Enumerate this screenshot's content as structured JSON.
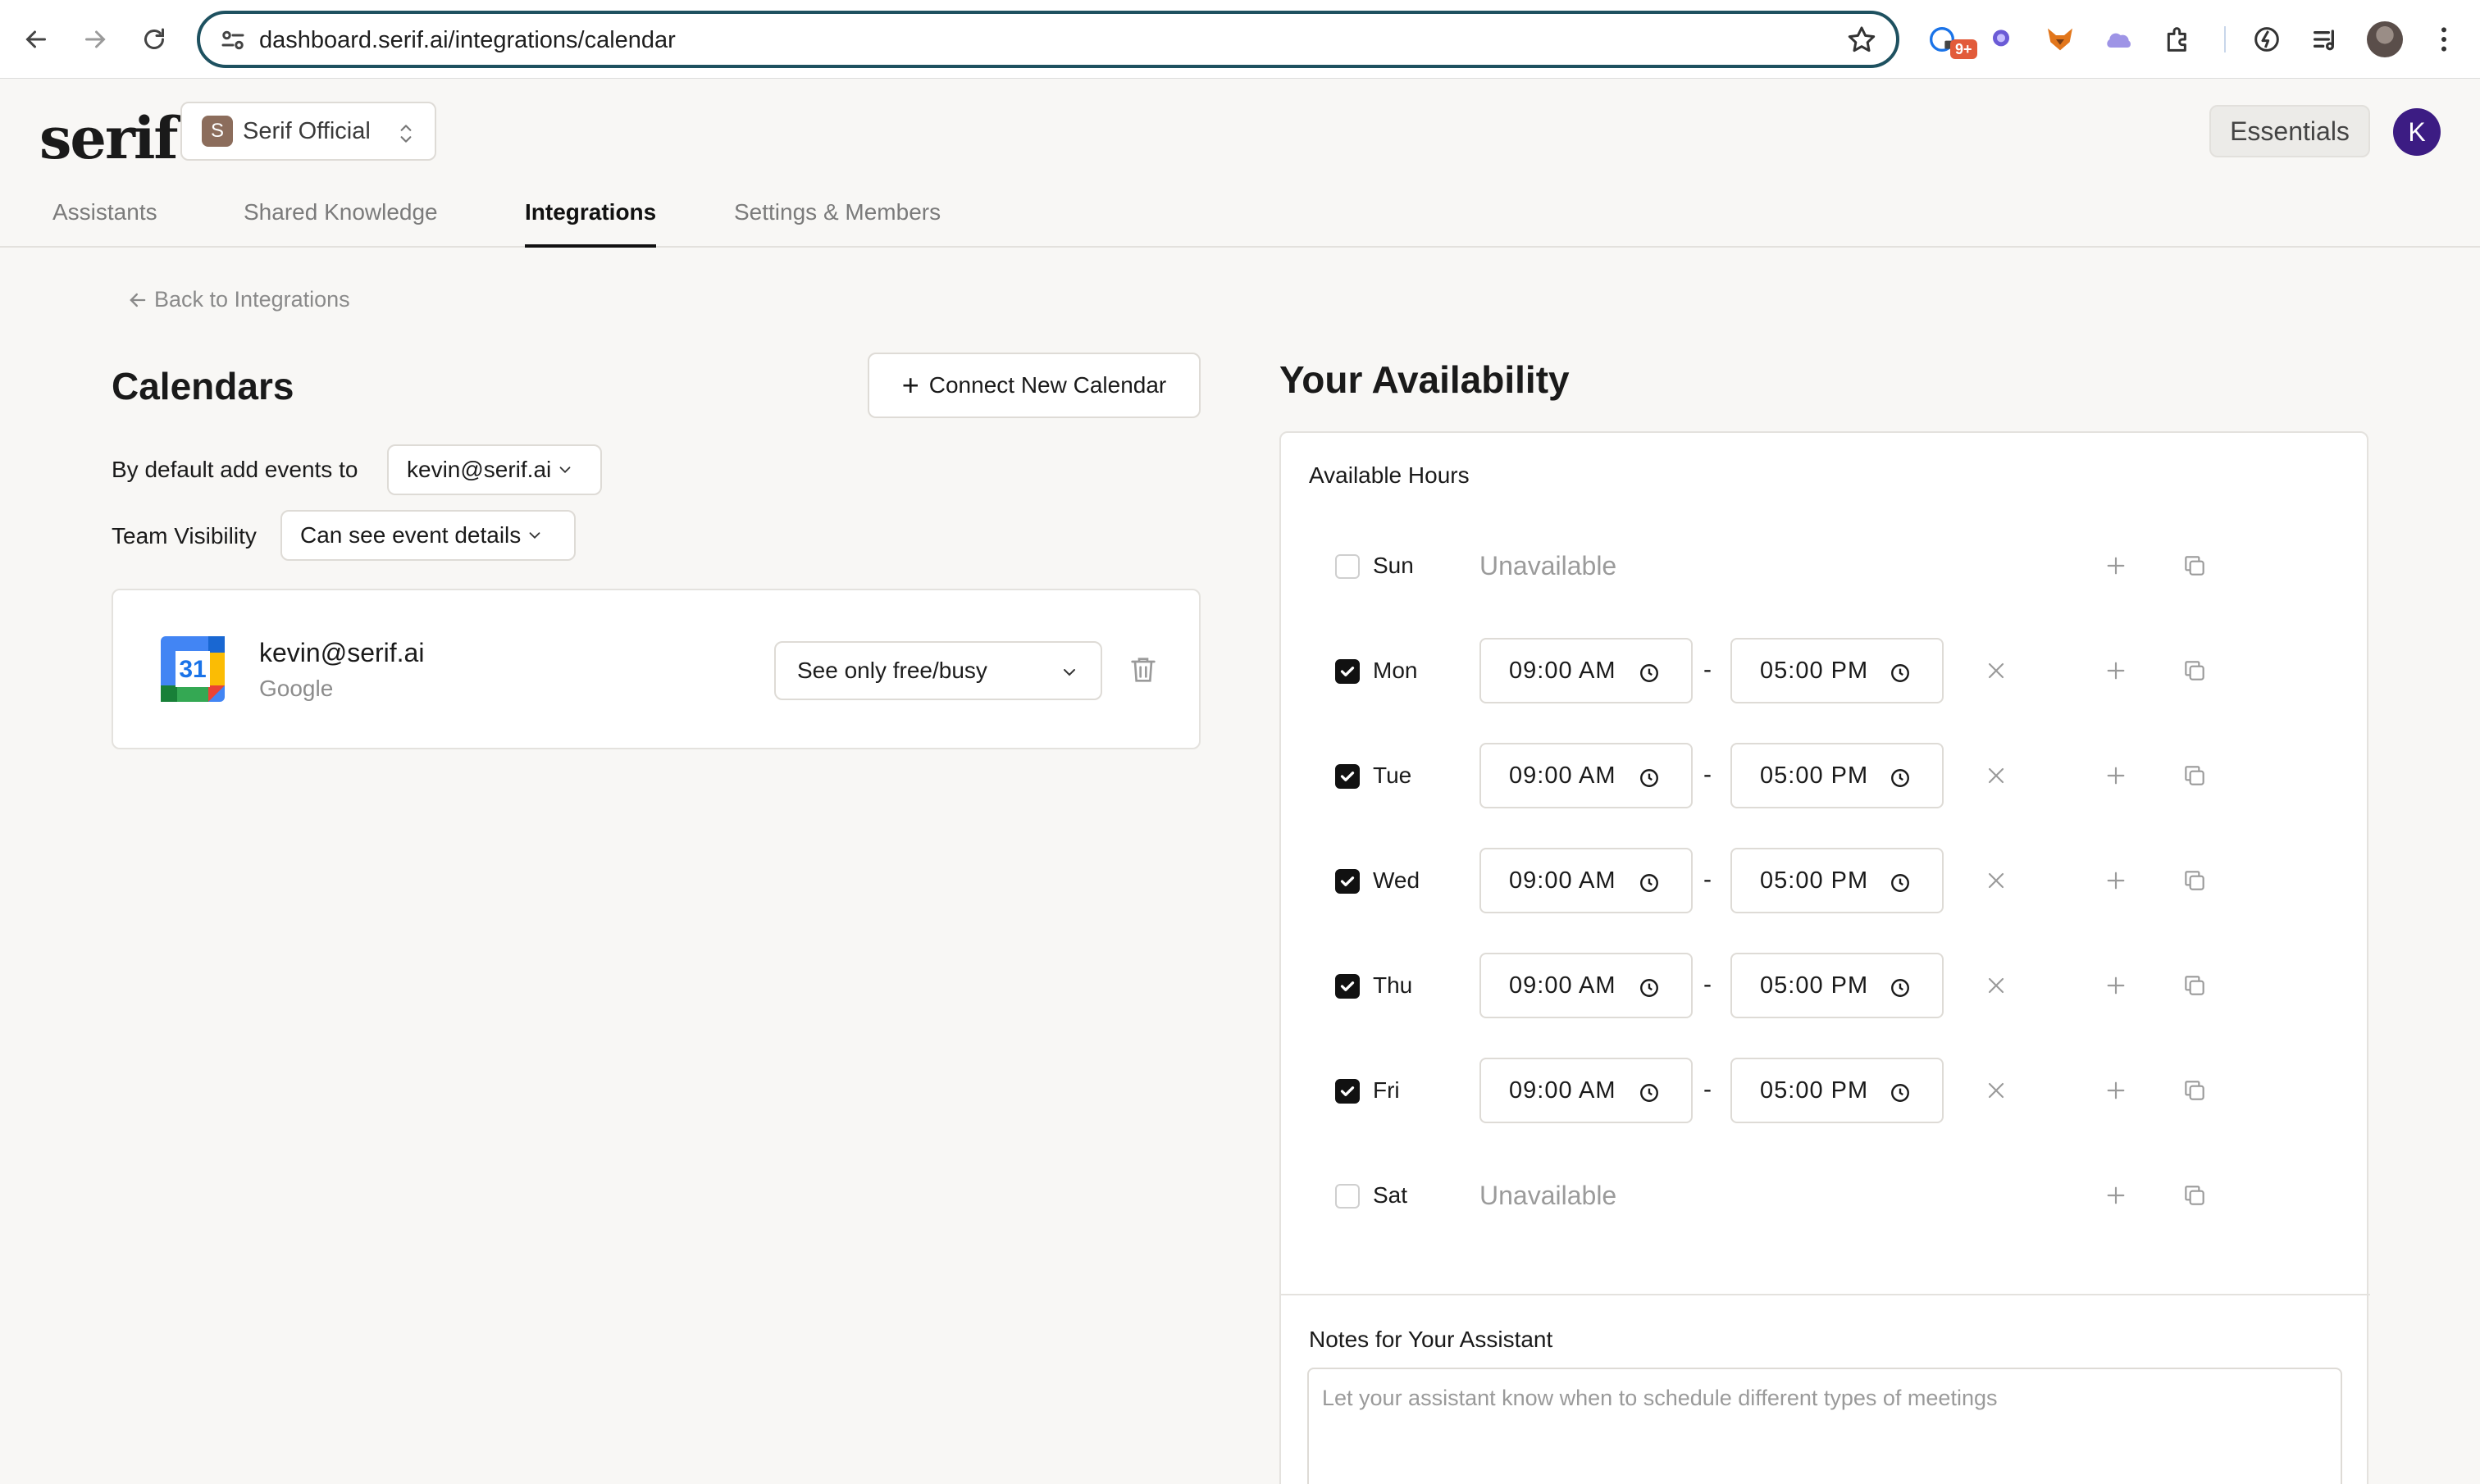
{
  "browser": {
    "url": "dashboard.serif.ai/integrations/calendar",
    "extension_badge": "9+"
  },
  "app": {
    "logo": "serif",
    "org": {
      "initial": "S",
      "name": "Serif Official"
    },
    "plan": "Essentials",
    "user_initial": "K",
    "tabs": [
      {
        "label": "Assistants"
      },
      {
        "label": "Shared Knowledge"
      },
      {
        "label": "Integrations"
      },
      {
        "label": "Settings & Members"
      }
    ],
    "active_tab": "Integrations",
    "back_link": "Back to Integrations"
  },
  "calendars": {
    "title": "Calendars",
    "connect_button": "Connect New Calendar",
    "default_label": "By default add events to",
    "default_value": "kevin@serif.ai",
    "team_visibility_label": "Team Visibility",
    "team_visibility_value": "Can see event details",
    "items": [
      {
        "email": "kevin@serif.ai",
        "provider": "Google",
        "icon_day": "31",
        "visibility": "See only free/busy"
      }
    ]
  },
  "availability": {
    "title": "Your Availability",
    "section_title": "Available Hours",
    "unavailable_text": "Unavailable",
    "days": [
      {
        "name": "Sun",
        "enabled": false
      },
      {
        "name": "Mon",
        "enabled": true,
        "start": "09:00 AM",
        "end": "05:00 PM"
      },
      {
        "name": "Tue",
        "enabled": true,
        "start": "09:00 AM",
        "end": "05:00 PM"
      },
      {
        "name": "Wed",
        "enabled": true,
        "start": "09:00 AM",
        "end": "05:00 PM"
      },
      {
        "name": "Thu",
        "enabled": true,
        "start": "09:00 AM",
        "end": "05:00 PM"
      },
      {
        "name": "Fri",
        "enabled": true,
        "start": "09:00 AM",
        "end": "05:00 PM"
      },
      {
        "name": "Sat",
        "enabled": false
      }
    ],
    "separator": "-",
    "notes_title": "Notes for Your Assistant",
    "notes_placeholder": "Let your assistant know when to schedule different types of meetings",
    "notes_value": ""
  },
  "colors": {
    "accent_dark": "#111111",
    "url_focus": "#1e5160",
    "user_avatar": "#3c1c83",
    "org_avatar": "#8c6d5c"
  }
}
